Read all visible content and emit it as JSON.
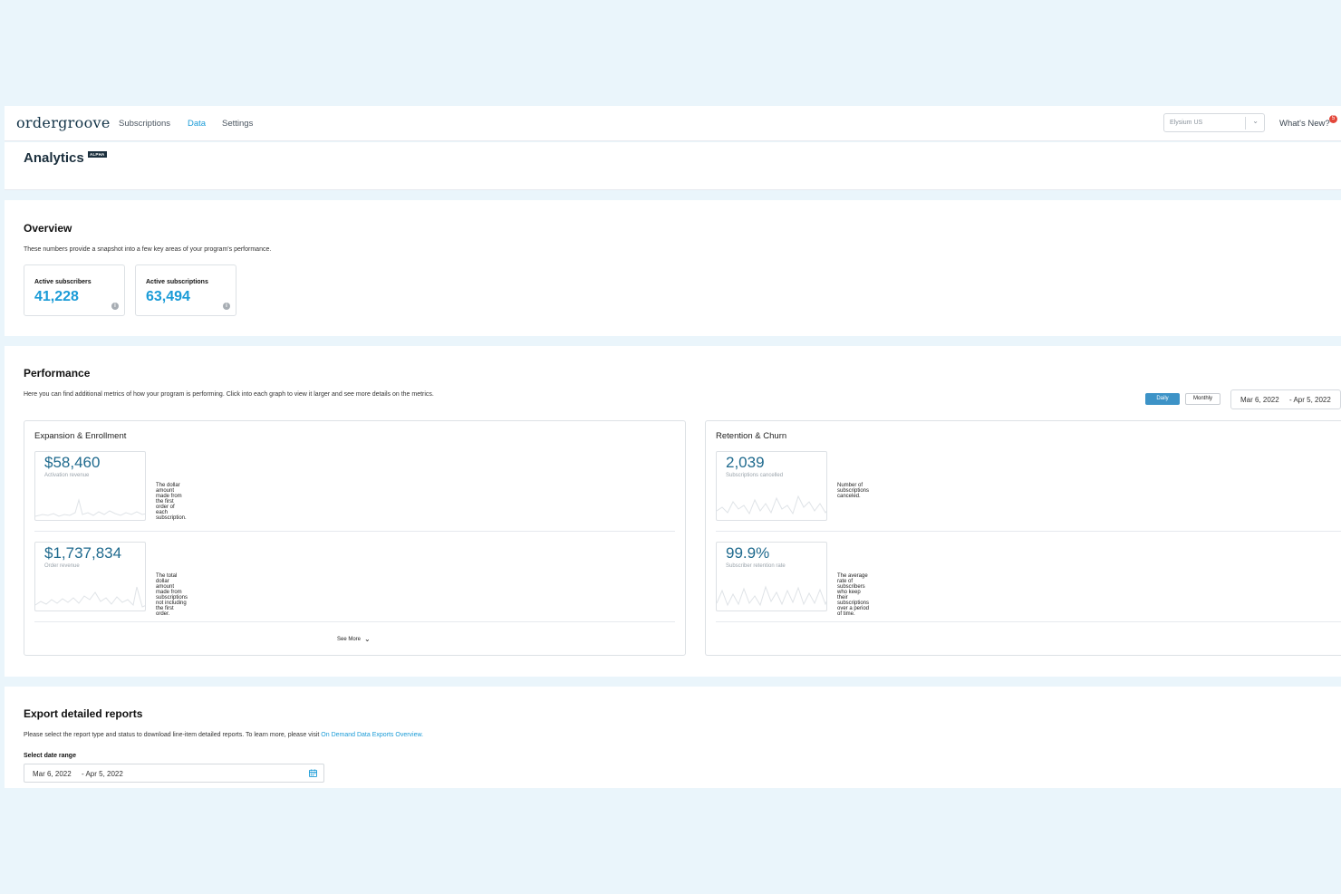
{
  "app": {
    "logo": "ordergroove",
    "nav": [
      "Subscriptions",
      "Data",
      "Settings"
    ],
    "active_nav": "Data",
    "store_select": "Elysium US",
    "whats_new": "What's New?",
    "notification_count": "5"
  },
  "page": {
    "title": "Analytics",
    "badge": "ALPHA"
  },
  "overview": {
    "heading": "Overview",
    "description": "These numbers provide a snapshot into a few key areas of your program's performance.",
    "cards": [
      {
        "label": "Active subscribers",
        "value": "41,228"
      },
      {
        "label": "Active subscriptions",
        "value": "63,494"
      }
    ]
  },
  "performance": {
    "heading": "Performance",
    "description": "Here you can find additional metrics of how your program is performing. Click into each graph to view it larger and see more details on the metrics.",
    "toggle": {
      "daily": "Daily",
      "monthly": "Monthly",
      "selected": "Daily"
    },
    "date_start": "Mar 6, 2022",
    "date_end": "- Apr 5, 2022",
    "groups": [
      {
        "title": "Expansion & Enrollment",
        "metrics": [
          {
            "value": "$58,460",
            "label": "Activation revenue",
            "description": "The dollar amount made from the first order of each subscription."
          },
          {
            "value": "$1,737,834",
            "label": "Order revenue",
            "description": "The total dollar amount made from subscriptions not including the first order."
          }
        ],
        "see_more": "See More"
      },
      {
        "title": "Retention & Churn",
        "metrics": [
          {
            "value": "2,039",
            "label": "Subscriptions cancelled",
            "description": "Number of subscriptions canceled."
          },
          {
            "value": "99.9%",
            "label": "Subscriber retention rate",
            "description": "The average rate of subscribers who keep their subscriptions over a period of time."
          }
        ]
      }
    ]
  },
  "export": {
    "heading": "Export detailed reports",
    "description": "Please select the report type and status to download line-item detailed reports. To learn more, please visit ",
    "link": "On Demand Data Exports Overview.",
    "field_label": "Select date range",
    "date_start": "Mar 6, 2022",
    "date_end": "- Apr 5, 2022"
  },
  "icons": {
    "info": "info-icon",
    "chevron": "chevron-down-icon",
    "calendar": "calendar-icon"
  },
  "colors": {
    "accent": "#1a9bd7",
    "metric_value": "#1f6a8e",
    "page_bg": "#eaf5fb",
    "badge": "#e3473a",
    "toggle_active": "#3d93c7"
  }
}
